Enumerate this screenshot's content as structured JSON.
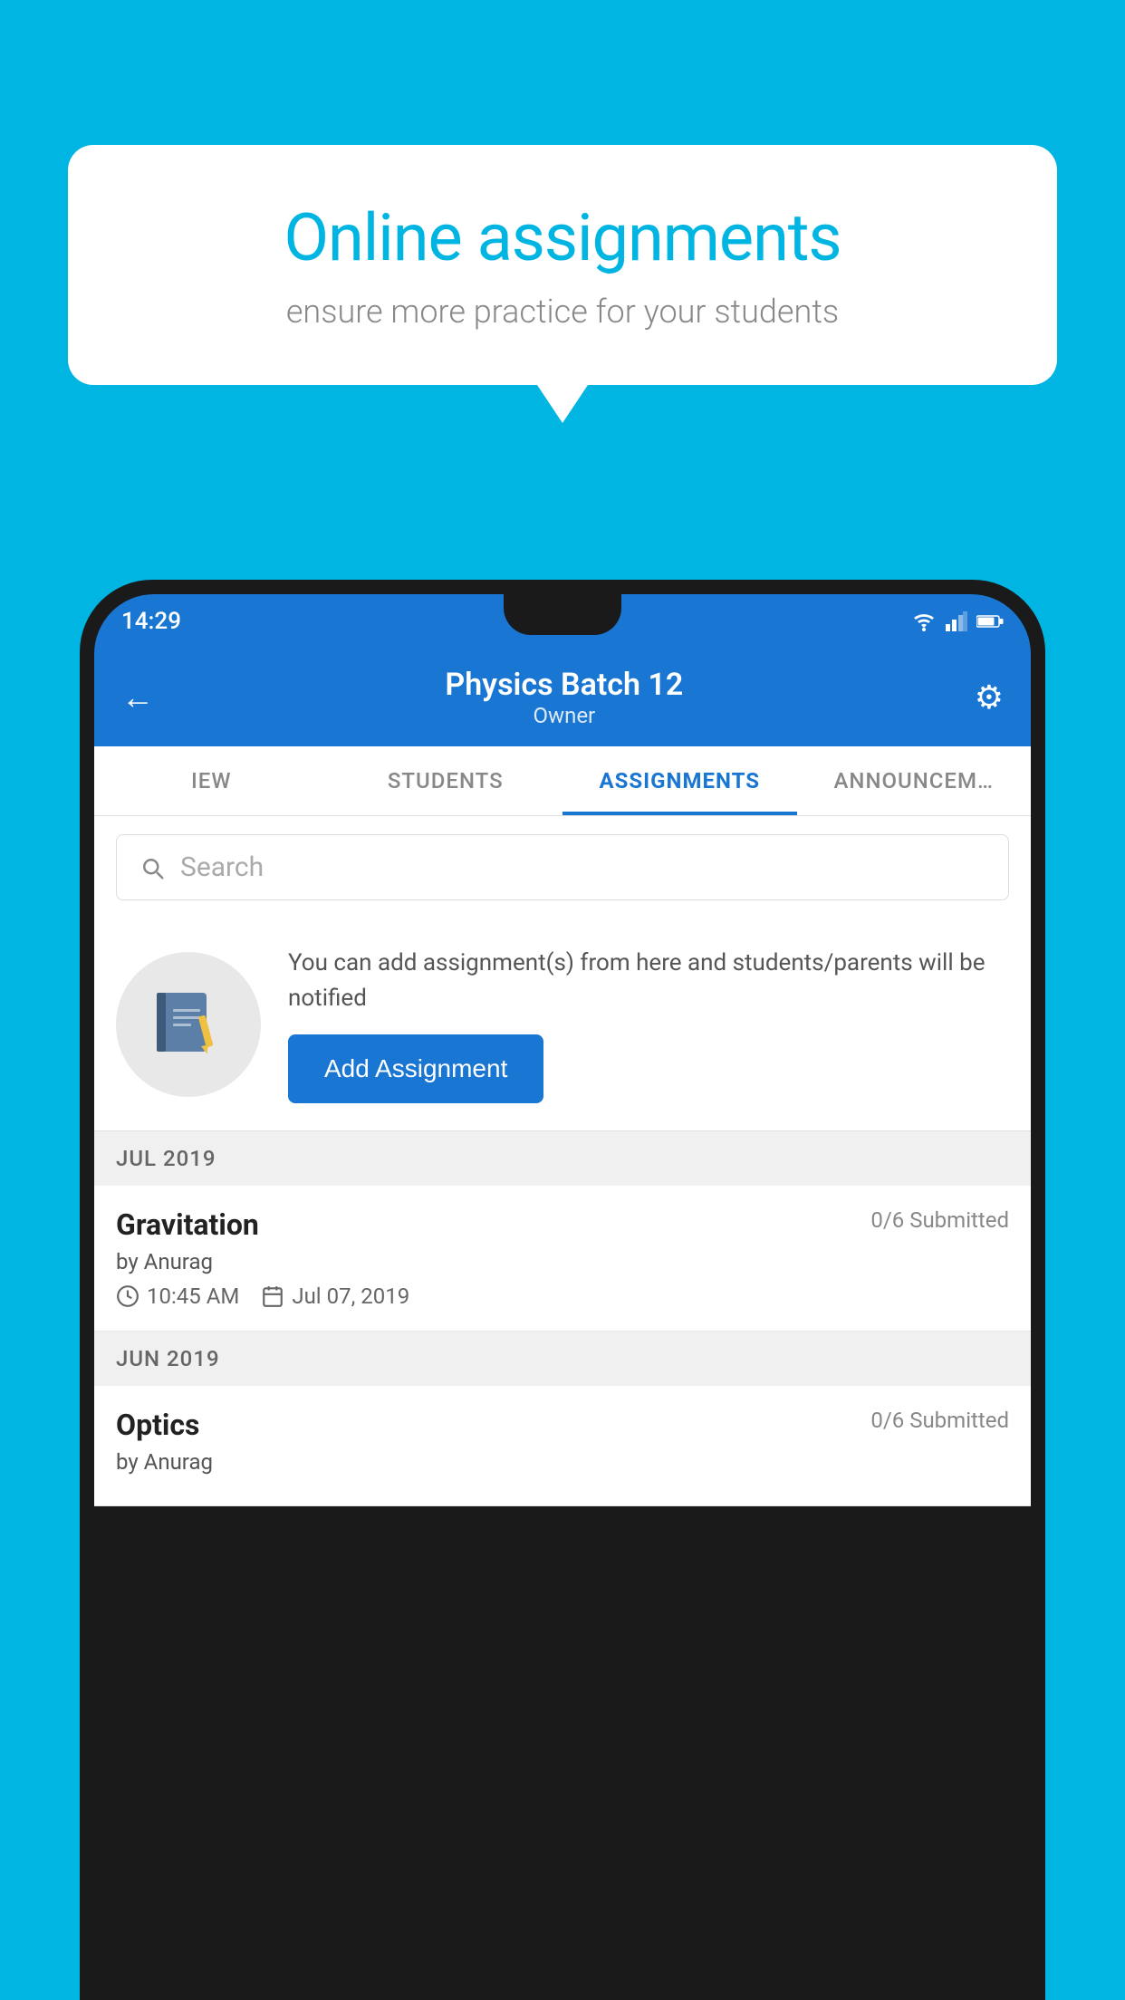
{
  "background_color": "#00b5e2",
  "speech_bubble": {
    "title": "Online assignments",
    "subtitle": "ensure more practice for your students"
  },
  "status_bar": {
    "time": "14:29",
    "icons": [
      "wifi",
      "signal",
      "battery"
    ]
  },
  "app_header": {
    "title": "Physics Batch 12",
    "subtitle": "Owner",
    "back_label": "←",
    "settings_label": "⚙"
  },
  "tabs": [
    {
      "label": "IEW",
      "active": false
    },
    {
      "label": "STUDENTS",
      "active": false
    },
    {
      "label": "ASSIGNMENTS",
      "active": true
    },
    {
      "label": "ANNOUNCEM…",
      "active": false
    }
  ],
  "search": {
    "placeholder": "Search"
  },
  "promo": {
    "text": "You can add assignment(s) from here and students/parents will be notified",
    "button_label": "Add Assignment"
  },
  "sections": [
    {
      "label": "JUL 2019",
      "assignments": [
        {
          "title": "Gravitation",
          "submitted": "0/6 Submitted",
          "by": "by Anurag",
          "time": "10:45 AM",
          "date": "Jul 07, 2019"
        }
      ]
    },
    {
      "label": "JUN 2019",
      "assignments": [
        {
          "title": "Optics",
          "submitted": "0/6 Submitted",
          "by": "by Anurag",
          "time": "",
          "date": ""
        }
      ]
    }
  ]
}
